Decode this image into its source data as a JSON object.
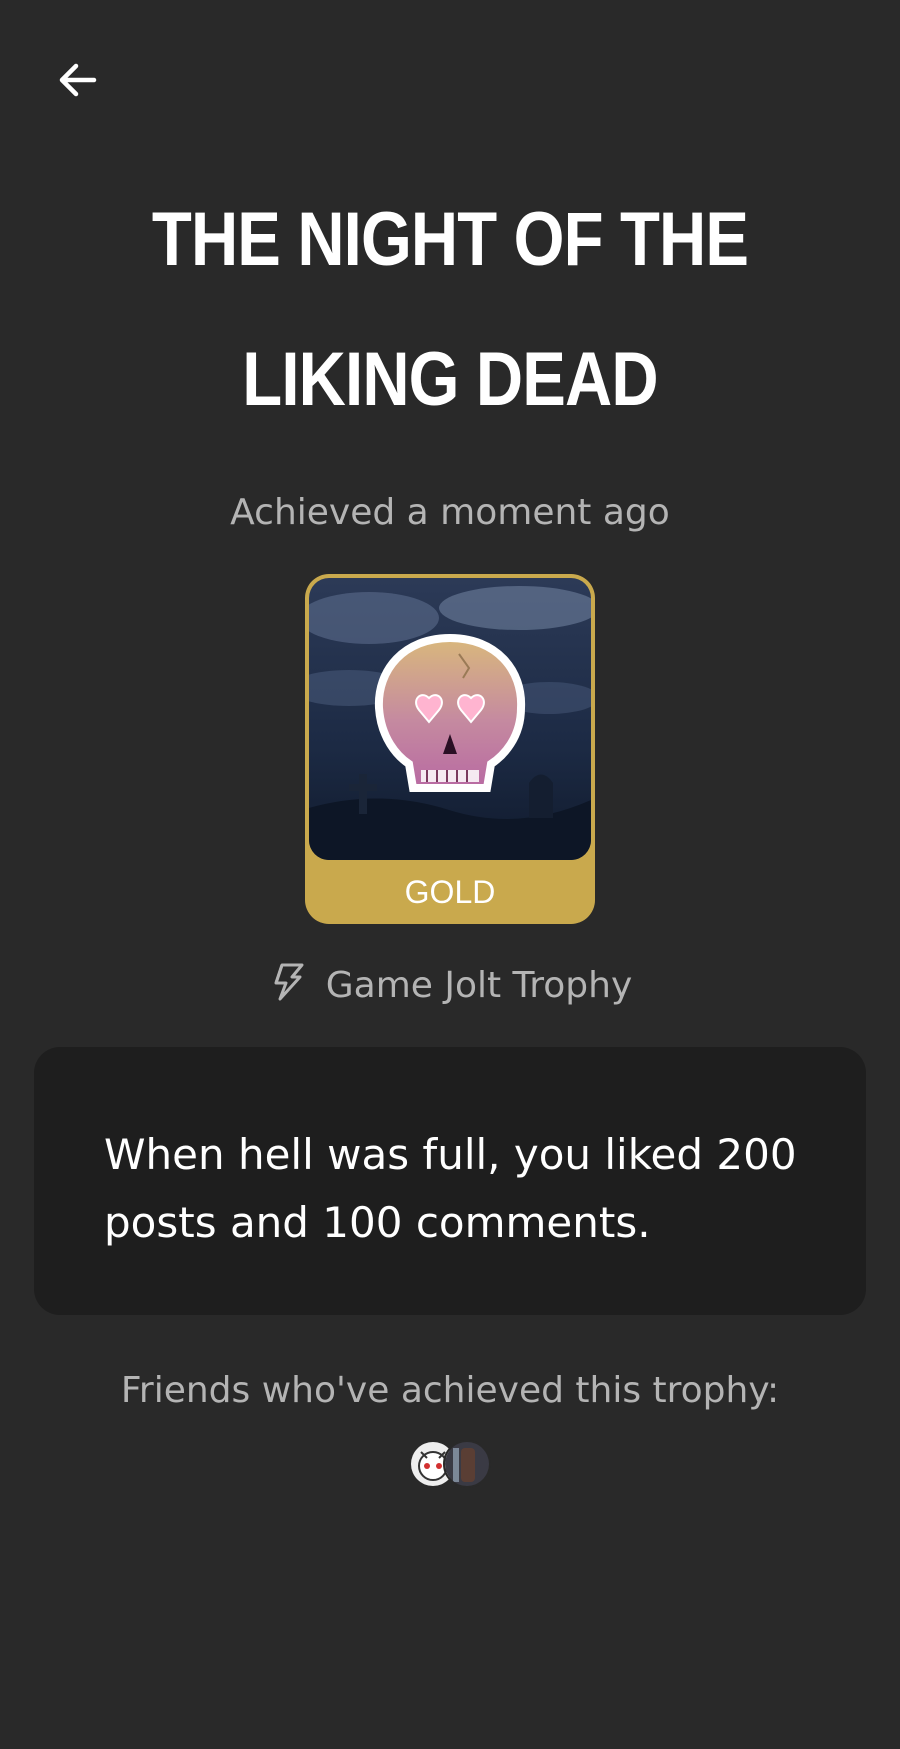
{
  "header": {
    "back_icon": "arrow-left-icon"
  },
  "trophy": {
    "title_line1": "THE NIGHT OF THE",
    "title_line2": "LIKING DEAD",
    "achieved": "Achieved a moment ago",
    "tier": "GOLD",
    "tier_color": "#c9a94d",
    "image_icon": "pink-skull-graveyard-image",
    "source_icon": "game-jolt-bolt-icon",
    "source": "Game Jolt Trophy",
    "description": "When hell was full, you liked 200 posts and 100 comments."
  },
  "friends": {
    "label": "Friends who've achieved this trophy:",
    "avatars": [
      "avatar-masked-character",
      "avatar-dark-figure"
    ]
  }
}
